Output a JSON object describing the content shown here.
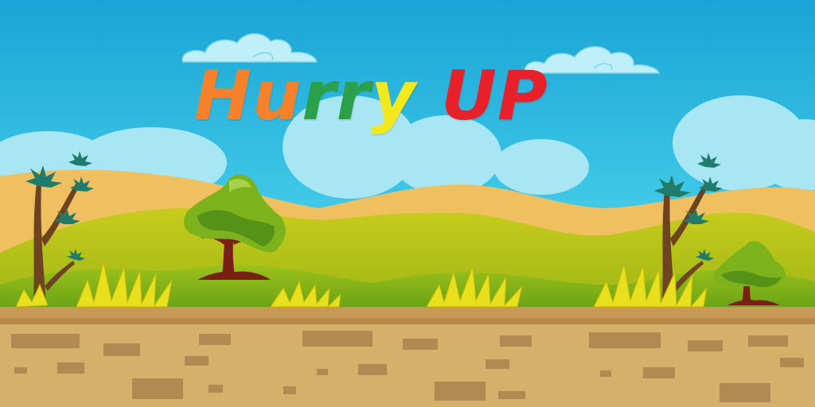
{
  "game": {
    "title_letters": [
      {
        "char": "H",
        "color": "#f5822a"
      },
      {
        "char": "u",
        "color": "#f5822a"
      },
      {
        "char": "r",
        "color": "#2aa048"
      },
      {
        "char": "r",
        "color": "#2aa048"
      },
      {
        "char": "y",
        "color": "#f2e81c"
      },
      {
        "char": " ",
        "color": "#000000"
      },
      {
        "char": "U",
        "color": "#e8202a"
      },
      {
        "char": "P",
        "color": "#e8202a"
      }
    ]
  },
  "palette": {
    "sky_top": "#1aa6d6",
    "sky_bottom": "#5cd2ea",
    "sand_hills": "#f0c060",
    "green_hills": "#b8c414",
    "grass": "#86b416",
    "ground": "#d4b06a",
    "ground_edge": "#c99a55",
    "brick": "#b08a52"
  },
  "icons": [
    "cloud-icon",
    "tree-icon",
    "palm-tree-icon",
    "grass-tuft-icon",
    "brick-icon"
  ]
}
